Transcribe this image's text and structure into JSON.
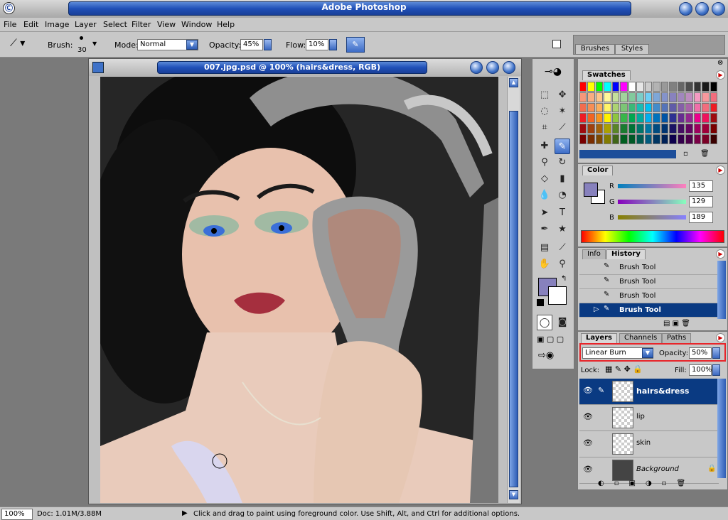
{
  "app": {
    "title": "Adobe Photoshop"
  },
  "menu": [
    "File",
    "Edit",
    "Image",
    "Layer",
    "Select",
    "Filter",
    "View",
    "Window",
    "Help"
  ],
  "options": {
    "brush_label": "Brush:",
    "brush_size": "30",
    "mode_label": "Mode:",
    "mode_value": "Normal",
    "opacity_label": "Opacity:",
    "opacity_value": "45%",
    "flow_label": "Flow:",
    "flow_value": "10%"
  },
  "palette_well": {
    "tabs": [
      "Brushes",
      "Styles"
    ]
  },
  "document": {
    "title": "007.jpg.psd @ 100% (hairs&dress, RGB)"
  },
  "swatches": {
    "title": "Swatches",
    "rows": [
      [
        "#ff0000",
        "#ffff00",
        "#00ff00",
        "#00ffff",
        "#0000ff",
        "#ff00ff",
        "#ffffff",
        "#e6e6e6",
        "#cccccc",
        "#b3b3b3",
        "#999999",
        "#808080",
        "#666666",
        "#4d4d4d",
        "#333333",
        "#1a1a1a",
        "#000000"
      ],
      [
        "#f7977a",
        "#f9ad81",
        "#fdc68a",
        "#fff79a",
        "#c4df9b",
        "#a2d39c",
        "#82ca9d",
        "#7bcdc8",
        "#6ecff6",
        "#7ea7d8",
        "#8493ca",
        "#8882be",
        "#a187be",
        "#bc8dbf",
        "#f49ac2",
        "#f6989d",
        "#f26d7d"
      ],
      [
        "#f26c4f",
        "#f68e55",
        "#fbaf5c",
        "#fff467",
        "#acd372",
        "#7cc576",
        "#3bb878",
        "#1abbb4",
        "#00bff3",
        "#438ccb",
        "#5574b9",
        "#605ca8",
        "#855fa8",
        "#a763a8",
        "#f06ea9",
        "#f26d7d",
        "#ed1c24"
      ],
      [
        "#ed1c24",
        "#f26522",
        "#f7941d",
        "#fff200",
        "#8dc63f",
        "#39b54a",
        "#00a651",
        "#00a99d",
        "#00aeef",
        "#0072bc",
        "#0054a6",
        "#2e3192",
        "#662d91",
        "#92278f",
        "#ec008c",
        "#ed145b",
        "#9e0b0f"
      ],
      [
        "#9e0b0f",
        "#a0410d",
        "#a36209",
        "#aba000",
        "#598527",
        "#1a7b30",
        "#007236",
        "#00746b",
        "#0076a3",
        "#004b80",
        "#003471",
        "#1b1464",
        "#440e62",
        "#630460",
        "#9e005d",
        "#9e0039",
        "#790000"
      ],
      [
        "#790000",
        "#7b2e00",
        "#7d4900",
        "#827b00",
        "#406618",
        "#005e20",
        "#005826",
        "#005952",
        "#005b7f",
        "#003663",
        "#002157",
        "#0d004c",
        "#32004b",
        "#4b0049",
        "#7b0046",
        "#7a0026",
        "#3a0000"
      ]
    ],
    "selected": "#1d4e9a"
  },
  "color_panel": {
    "title": "Color",
    "r_label": "R",
    "r_value": "135",
    "g_label": "G",
    "g_value": "129",
    "b_label": "B",
    "b_value": "189",
    "foreground": "#8781bd",
    "background": "#ffffff"
  },
  "history": {
    "tabs": [
      "Info",
      "History"
    ],
    "items": [
      "Brush Tool",
      "Brush Tool",
      "Brush Tool",
      "Brush Tool"
    ],
    "active_index": 3
  },
  "layers": {
    "tabs": [
      "Layers",
      "Channels",
      "Paths"
    ],
    "blend_mode": "Linear Burn",
    "opacity_label": "Opacity:",
    "opacity_value": "50%",
    "lock_label": "Lock:",
    "fill_label": "Fill:",
    "fill_value": "100%",
    "items": [
      {
        "name": "hairs&dress",
        "active": true
      },
      {
        "name": "lip",
        "active": false
      },
      {
        "name": "skin",
        "active": false
      },
      {
        "name": "Background",
        "active": false
      }
    ]
  },
  "status": {
    "zoom": "100%",
    "doc": "Doc: 1.01M/3.88M",
    "hint": "Click and drag to paint using foreground color.  Use Shift, Alt, and Ctrl for additional options."
  },
  "colors": {
    "accent_blue": "#0a3a82",
    "highlight": "#e8252a"
  }
}
